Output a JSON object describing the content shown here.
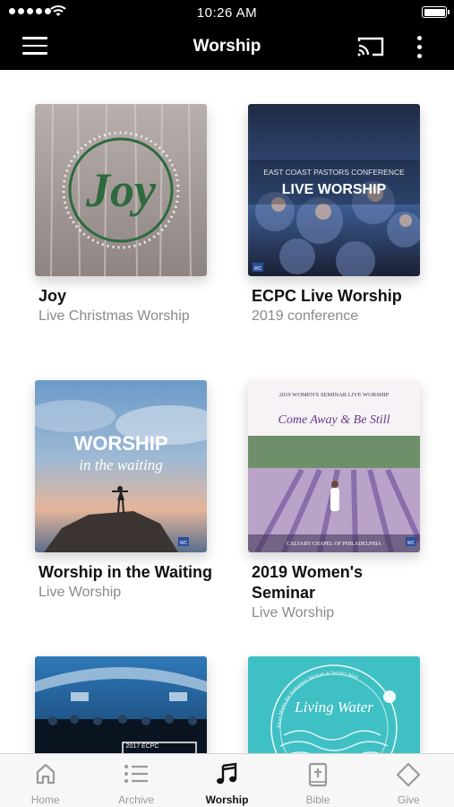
{
  "status_bar": {
    "time": "10:26 AM"
  },
  "header": {
    "title": "Worship"
  },
  "albums": [
    {
      "title": "Joy",
      "subtitle": "Live Christmas Worship"
    },
    {
      "title": "ECPC Live Worship",
      "subtitle": "2019 conference"
    },
    {
      "title": "Worship in the Waiting",
      "subtitle": "Live Worship"
    },
    {
      "title": "2019 Women's Seminar",
      "subtitle": "Live Worship"
    },
    {
      "title": "",
      "subtitle": ""
    },
    {
      "title": "",
      "subtitle": ""
    }
  ],
  "artwork": {
    "joy": {
      "word": "Joy"
    },
    "ecpc": {
      "line1": "EAST COAST PASTORS CONFERENCE",
      "line2": "LIVE WORSHIP",
      "badge": "WC"
    },
    "waiting": {
      "line1": "WORSHIP",
      "line2": "in the waiting",
      "badge": "WC"
    },
    "seminar": {
      "top": "2019 WOMEN'S SEMINAR LIVE WORSHIP",
      "script": "Come Away & Be Still",
      "bottom": "CALVARY CHAPEL OF PHILADELPHIA",
      "badge": "WC"
    },
    "conf2017": {
      "label": "2017 ECPC"
    },
    "living": {
      "word": "Living Water",
      "ring": "Jesus Meets the Samaritan Woman at Jacob's Well"
    }
  },
  "tabs": [
    {
      "label": "Home",
      "icon": "home-icon"
    },
    {
      "label": "Archive",
      "icon": "list-icon"
    },
    {
      "label": "Worship",
      "icon": "music-note-icon",
      "active": true
    },
    {
      "label": "Bible",
      "icon": "bible-icon"
    },
    {
      "label": "Give",
      "icon": "diamond-icon"
    }
  ],
  "colors": {
    "bar": "#000000",
    "accent": "#111111",
    "inactive": "#9a9a9a"
  }
}
